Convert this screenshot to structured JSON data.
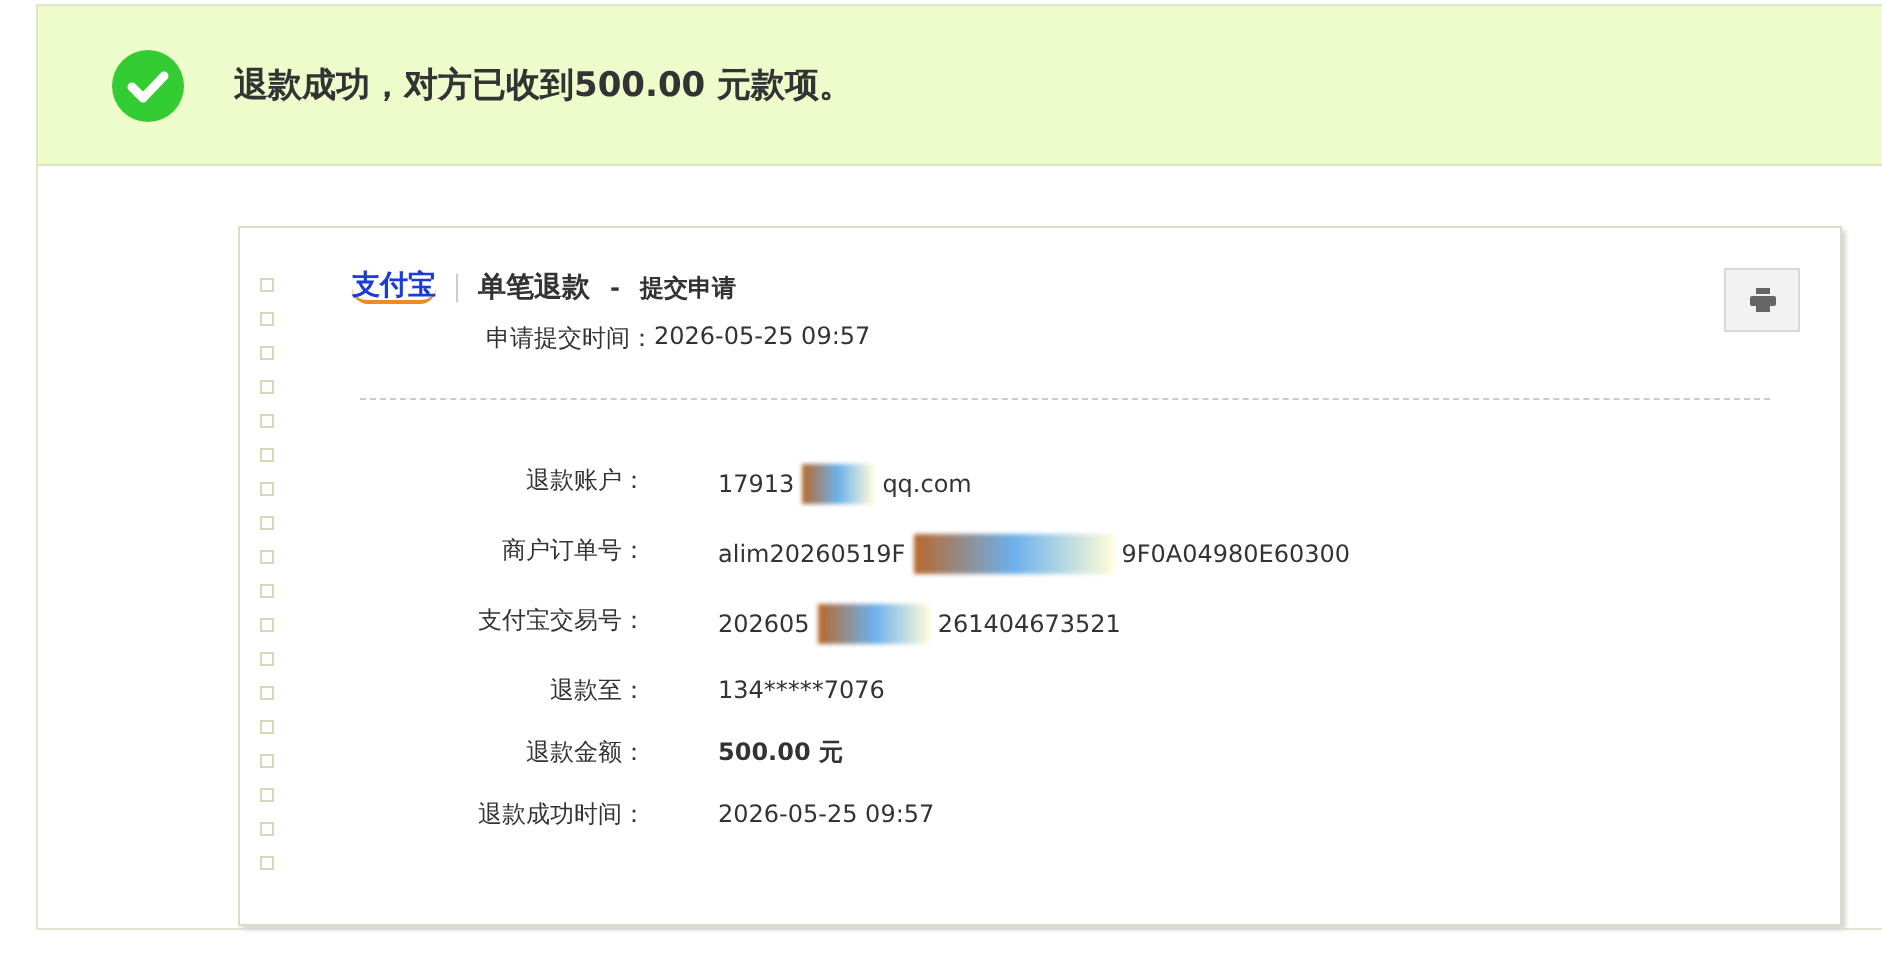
{
  "banner": {
    "message": "退款成功，对方已收到**500.00** 元款项。"
  },
  "receipt": {
    "logo": "支付宝",
    "title": "单笔退款",
    "dash": "-",
    "step": "提交申请",
    "submitted": {
      "label": "申请提交时间：",
      "value": "2026-05-25 09:57"
    },
    "rows": [
      {
        "label": "退款账户：",
        "value_parts": [
          "17913",
          "qq.com"
        ],
        "bold": false
      },
      {
        "label": "商户订单号：",
        "value_parts": [
          "alim20260519F",
          "9F0A04980E60300"
        ],
        "bold": false
      },
      {
        "label": "支付宝交易号：",
        "value_parts": [
          "202605",
          "261404673521"
        ],
        "bold": false
      },
      {
        "label": "退款至：",
        "value_parts": [
          "134*****7076"
        ],
        "bold": false
      },
      {
        "label": "退款金额：",
        "value_parts": [
          "500.00 元"
        ],
        "bold": true
      },
      {
        "label": "退款成功时间：",
        "value_parts": [
          "2026-05-25 09:57"
        ],
        "bold": false
      }
    ]
  }
}
